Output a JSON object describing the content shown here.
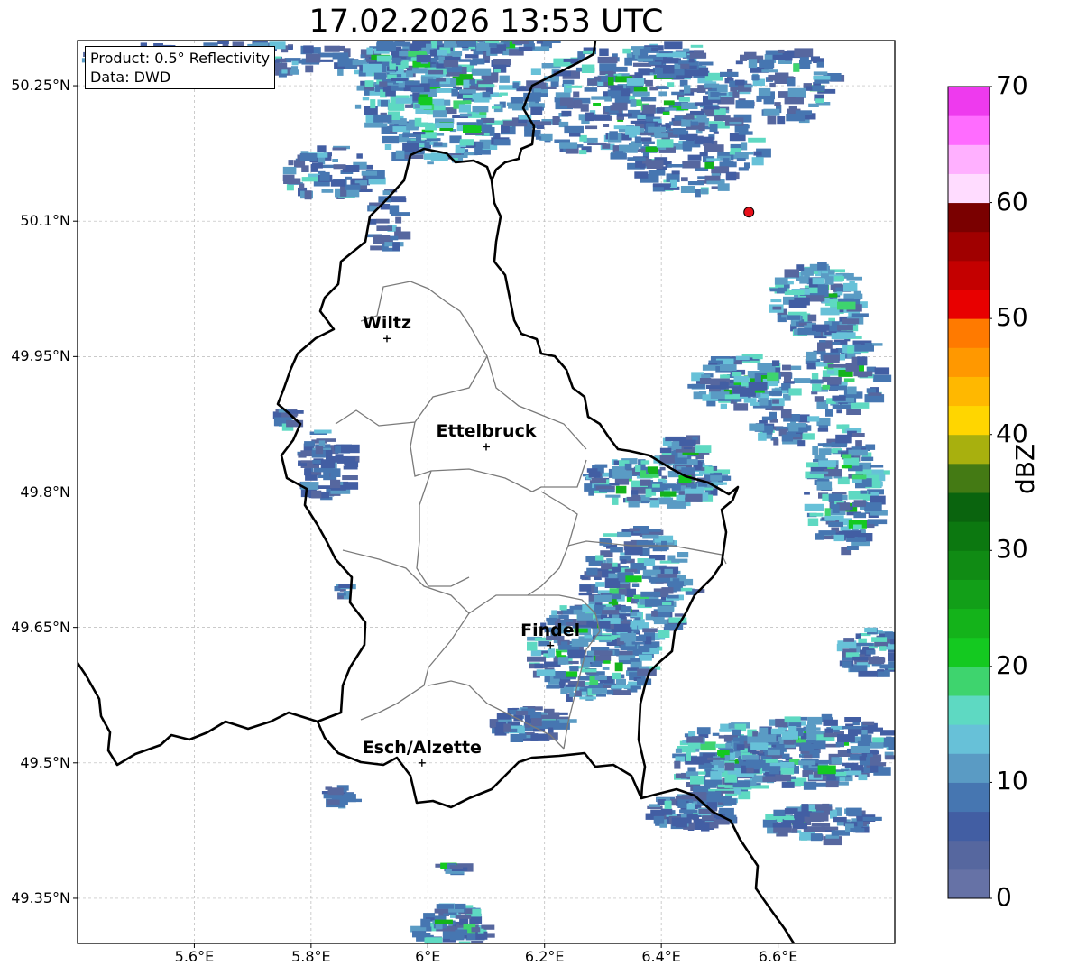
{
  "title": "17.02.2026 13:53 UTC",
  "info": {
    "product": "Product: 0.5° Reflectivity",
    "source": "Data: DWD"
  },
  "map": {
    "lon_range": [
      5.4,
      6.8
    ],
    "lat_range": [
      49.3,
      50.3
    ],
    "lat_ticks": [
      "49.35°N",
      "49.5°N",
      "49.65°N",
      "49.8°N",
      "49.95°N",
      "50.1°N",
      "50.25°N"
    ],
    "lon_ticks": [
      "5.6°E",
      "5.8°E",
      "6°E",
      "6.2°E",
      "6.4°E",
      "6.6°E"
    ],
    "gridlines": true
  },
  "cities": [
    {
      "name": "Wiltz",
      "lon": 5.93,
      "lat": 49.97
    },
    {
      "name": "Ettelbruck",
      "lon": 6.1,
      "lat": 49.85
    },
    {
      "name": "Findel",
      "lon": 6.21,
      "lat": 49.63
    },
    {
      "name": "Esch/Alzette",
      "lon": 5.99,
      "lat": 49.5
    }
  ],
  "radar_marker": {
    "lon": 6.55,
    "lat": 50.11,
    "color": "#e8101a"
  },
  "colorbar": {
    "label": "dBZ",
    "ticks": [
      "0",
      "10",
      "20",
      "30",
      "40",
      "50",
      "60",
      "70"
    ],
    "colors": [
      "#6672a6",
      "#56679f",
      "#425ea3",
      "#4676b1",
      "#5a9bc4",
      "#67c1d8",
      "#5ed9c2",
      "#3ed46e",
      "#14c920",
      "#14b31a",
      "#129f18",
      "#108b14",
      "#0c7810",
      "#0a640e",
      "#447a14",
      "#a8b00e",
      "#ffd600",
      "#ffb800",
      "#ff9800",
      "#ff7a00",
      "#e80000",
      "#c40000",
      "#a00000",
      "#7a0000",
      "#ffdcff",
      "#ffb0ff",
      "#ff6cff",
      "#ee3aee"
    ]
  }
}
